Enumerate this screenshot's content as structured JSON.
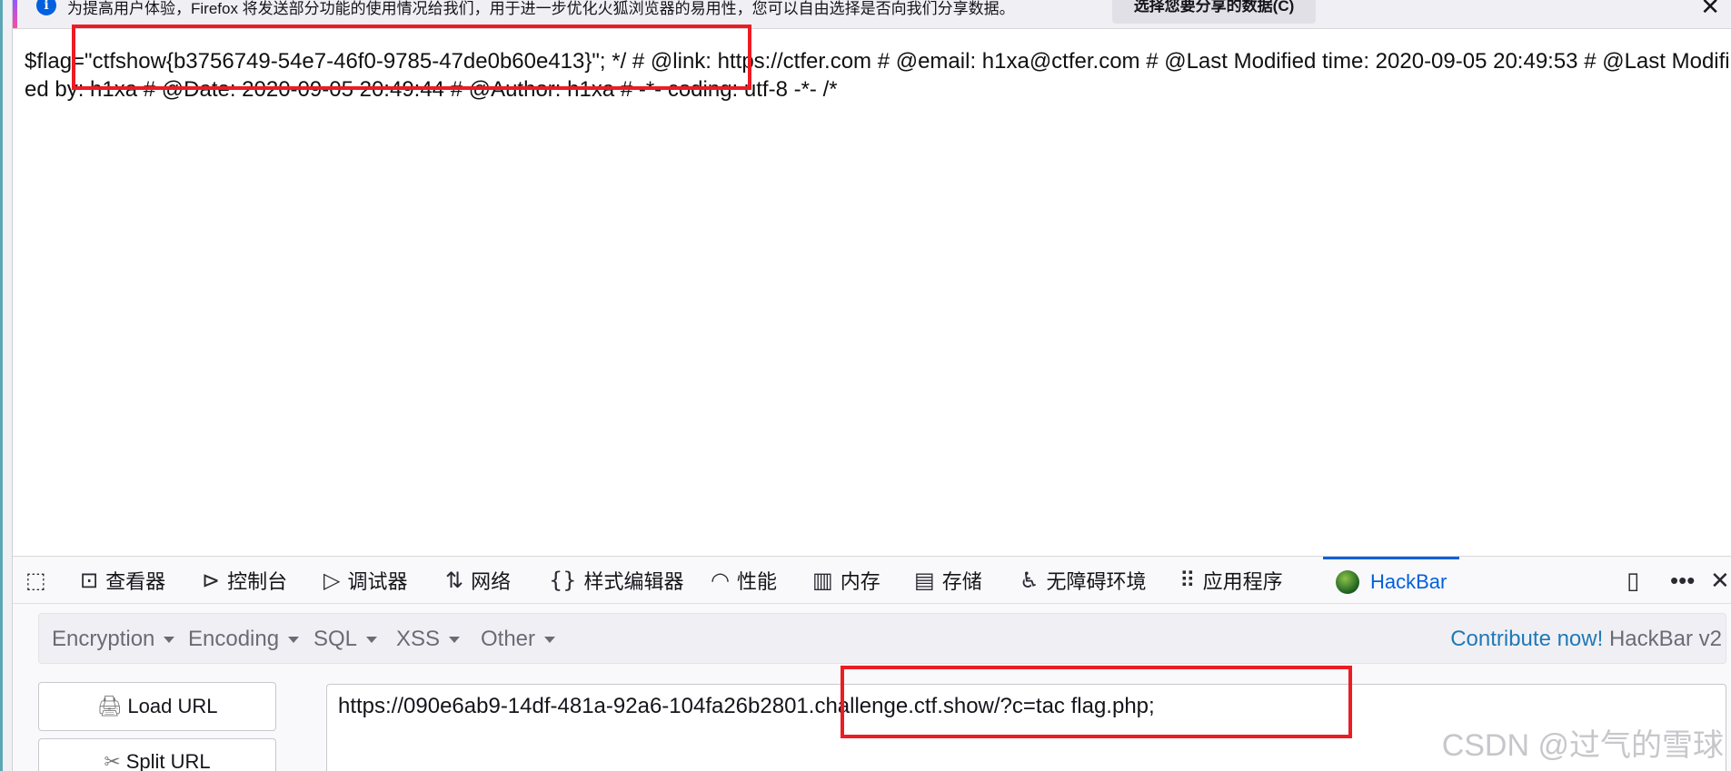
{
  "notification": {
    "text": "为提高用户体验，Firefox 将发送部分功能的使用情况给我们，用于进一步优化火狐浏览器的易用性，您可以自由选择是否向我们分享数据。",
    "button_label": "选择您要分享的数据(C)",
    "close_glyph": "✕"
  },
  "page": {
    "code_text": "$flag=\"ctfshow{b3756749-54e7-46f0-9785-47de0b60e413}\"; */ # @link: https://ctfer.com # @email: h1xa@ctfer.com # @Last Modified time: 2020-09-05 20:49:53 # @Last Modified by: h1xa # @Date: 2020-09-05 20:49:44 # @Author: h1xa # -*- coding: utf-8 -*- /*"
  },
  "devtools": {
    "tabs": [
      {
        "label": "查看器"
      },
      {
        "label": "控制台"
      },
      {
        "label": "调试器"
      },
      {
        "label": "网络"
      },
      {
        "label": "样式编辑器"
      },
      {
        "label": "性能"
      },
      {
        "label": "内存"
      },
      {
        "label": "存储"
      },
      {
        "label": "无障碍环境"
      },
      {
        "label": "应用程序"
      },
      {
        "label": "HackBar"
      }
    ],
    "active_tab": "HackBar"
  },
  "hackbar": {
    "menu": [
      {
        "label": "Encryption"
      },
      {
        "label": "Encoding"
      },
      {
        "label": "SQL"
      },
      {
        "label": "XSS"
      },
      {
        "label": "Other"
      }
    ],
    "contribute_link": "Contribute now!",
    "version_label": "HackBar v2",
    "load_url_label": "Load URL",
    "split_url_label": "Split URL",
    "url_value": "https://090e6ab9-14df-481a-92a6-104fa26b2801.challenge.ctf.show/?c=tac flag.php;"
  },
  "watermark": "CSDN @过气的雪球",
  "colors": {
    "accent": "#0060df",
    "annotation": "#ec1c24",
    "link": "#1f79b8"
  }
}
